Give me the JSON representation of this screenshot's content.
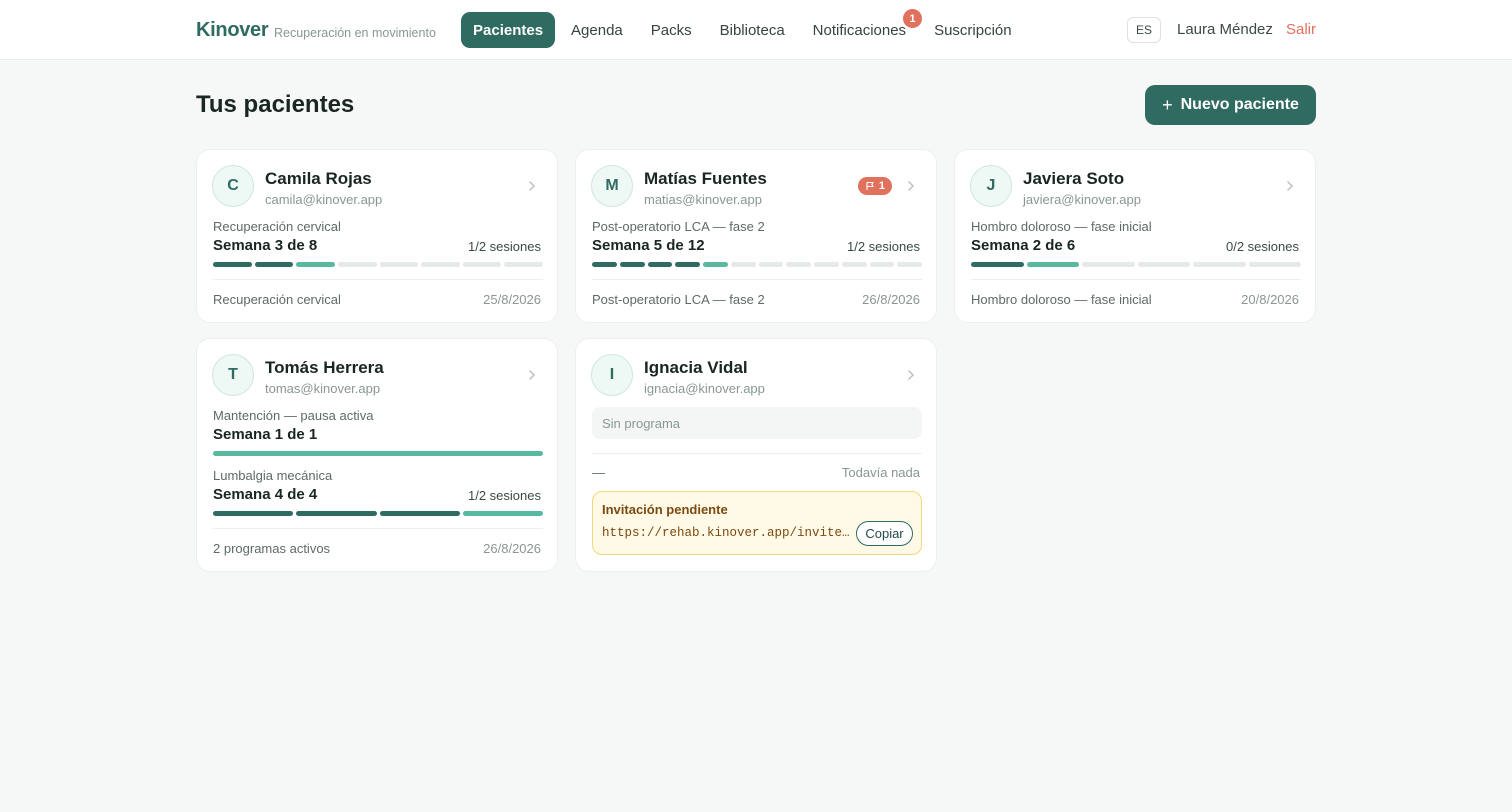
{
  "header": {
    "brand": "Kinover",
    "tagline": "Recuperación en movimiento",
    "nav": [
      {
        "label": "Pacientes",
        "active": true
      },
      {
        "label": "Agenda"
      },
      {
        "label": "Packs"
      },
      {
        "label": "Biblioteca"
      },
      {
        "label": "Notificaciones",
        "badge": "1"
      },
      {
        "label": "Suscripción"
      }
    ],
    "language": "ES",
    "user_name": "Laura Méndez",
    "logout_label": "Salir"
  },
  "main": {
    "title": "Tus pacientes",
    "new_patient_label": "Nuevo paciente",
    "new_patient_icon": "plus-icon"
  },
  "colors": {
    "brand": "#2f6b61",
    "segment_done": "#2f6b61",
    "segment_current": "#58b8a0",
    "segment_pending": "#e5e9e9",
    "alert": "#e0715d",
    "invite_bg": "#fff9e6"
  },
  "patients": [
    {
      "initial": "C",
      "name": "Camila Rojas",
      "email": "camila@kinover.app",
      "programs": [
        {
          "label": "Recuperación cervical",
          "week": "Semana 3 de 8",
          "sessions": "1/2 sesiones",
          "total_weeks": 8,
          "completed_weeks": 2,
          "current_week": 3
        }
      ],
      "footer_left": "Recuperación cervical",
      "footer_right": "25/8/2026"
    },
    {
      "initial": "M",
      "name": "Matías Fuentes",
      "email": "matias@kinover.app",
      "messages_badge": "1",
      "programs": [
        {
          "label": "Post-operatorio LCA — fase 2",
          "week": "Semana 5 de 12",
          "sessions": "1/2 sesiones",
          "total_weeks": 12,
          "completed_weeks": 4,
          "current_week": 5
        }
      ],
      "footer_left": "Post-operatorio LCA — fase 2",
      "footer_right": "26/8/2026"
    },
    {
      "initial": "J",
      "name": "Javiera Soto",
      "email": "javiera@kinover.app",
      "programs": [
        {
          "label": "Hombro doloroso — fase inicial",
          "week": "Semana 2 de 6",
          "sessions": "0/2 sesiones",
          "total_weeks": 6,
          "completed_weeks": 1,
          "current_week": 2
        }
      ],
      "footer_left": "Hombro doloroso — fase inicial",
      "footer_right": "20/8/2026"
    },
    {
      "initial": "T",
      "name": "Tomás Herrera",
      "email": "tomas@kinover.app",
      "programs": [
        {
          "label": "Mantención — pausa activa",
          "week": "Semana 1 de 1",
          "sessions": "",
          "total_weeks": 1,
          "completed_weeks": 0,
          "current_week": 1
        },
        {
          "label": "Lumbalgia mecánica",
          "week": "Semana 4 de 4",
          "sessions": "1/2 sesiones",
          "total_weeks": 4,
          "completed_weeks": 3,
          "current_week": 4
        }
      ],
      "footer_left": "2 programas activos",
      "footer_right": "26/8/2026"
    },
    {
      "initial": "I",
      "name": "Ignacia Vidal",
      "email": "ignacia@kinover.app",
      "no_program": "Sin programa",
      "footer_left": "—",
      "footer_right": "Todavía nada",
      "invitation": {
        "title": "Invitación pendiente",
        "link": "https://rehab.kinover.app/invite/…",
        "copy_label": "Copiar"
      }
    }
  ]
}
